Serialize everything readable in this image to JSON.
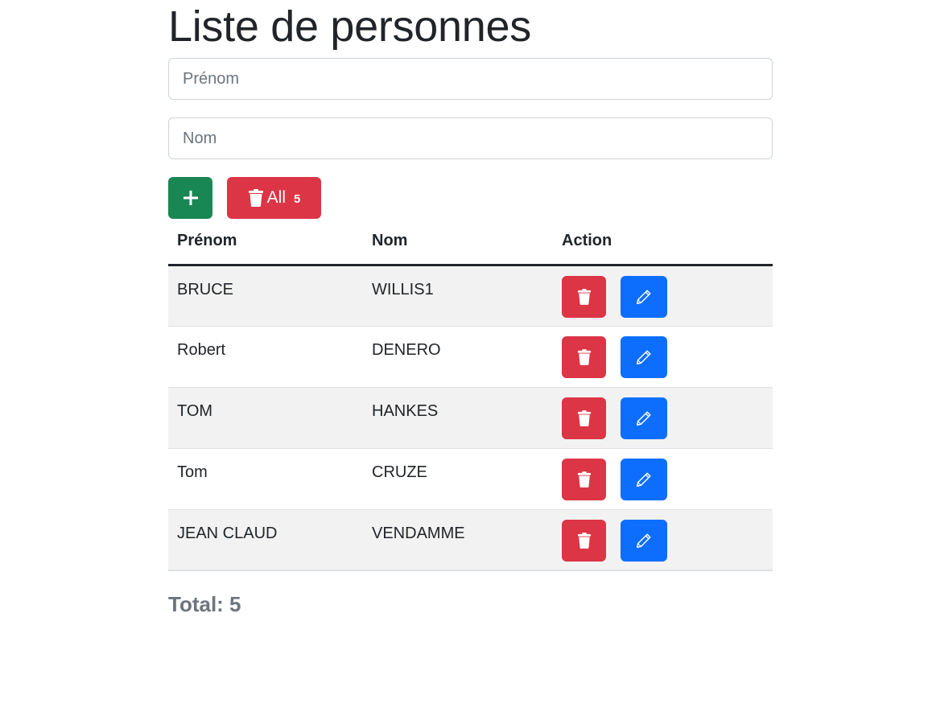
{
  "title": "Liste de personnes",
  "form": {
    "prenom_placeholder": "Prénom",
    "nom_placeholder": "Nom",
    "prenom_value": "",
    "nom_value": ""
  },
  "buttons": {
    "add_icon": "plus-icon",
    "delete_all_label": "All",
    "delete_all_count": "5",
    "delete_all_icon": "trash-icon"
  },
  "table": {
    "headers": [
      "Prénom",
      "Nom",
      "Action"
    ],
    "rows": [
      {
        "prenom": "BRUCE",
        "nom": "WILLIS1"
      },
      {
        "prenom": "Robert",
        "nom": "DENERO"
      },
      {
        "prenom": "TOM",
        "nom": "HANKES"
      },
      {
        "prenom": "Tom",
        "nom": "CRUZE"
      },
      {
        "prenom": "JEAN CLAUD",
        "nom": "VENDAMME"
      }
    ],
    "row_actions": {
      "delete_icon": "trash-icon",
      "edit_icon": "pencil-icon"
    }
  },
  "total": "Total: 5",
  "colors": {
    "success": "#198754",
    "danger": "#dc3545",
    "primary": "#0d6efd",
    "muted": "#6c757d",
    "stripe": "#f2f2f2"
  }
}
